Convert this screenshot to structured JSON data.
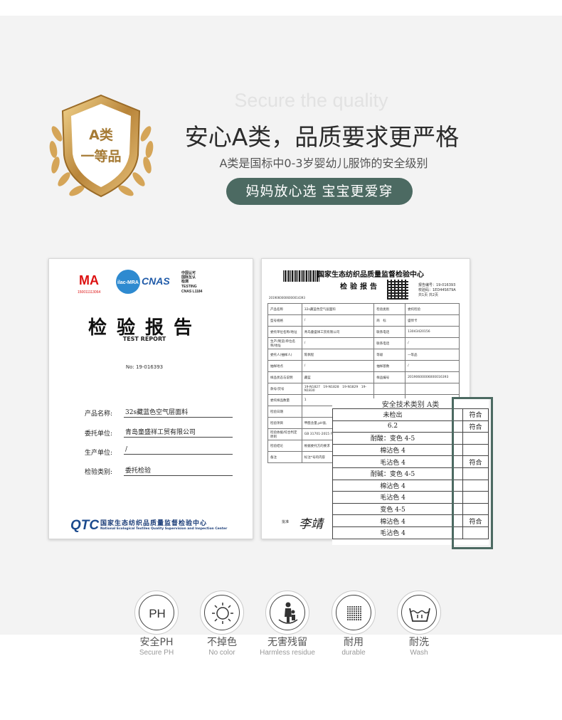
{
  "badge": {
    "line1": "A类",
    "line2": "一等品"
  },
  "header": {
    "subtitle_en": "Secure the quality",
    "headline": "安心A类，品质要求更严格",
    "description": "A类是国标中0-3岁婴幼儿服饰的安全级别",
    "pill": "妈妈放心选 宝宝更爱穿"
  },
  "report_cover": {
    "logo_ma": "MA",
    "logo_ma_number": "150011113064",
    "logo_ilac": "ilac-MRA",
    "logo_cnas": "CNAS",
    "cnas_cn_1": "中国认可",
    "cnas_cn_2": "国际互认",
    "cnas_cn_3": "检测",
    "cnas_testing": "TESTING",
    "cnas_number": "CNAS L1184",
    "title": "检验报告",
    "title_en": "TEST REPORT",
    "report_no": "No: 19-016393",
    "fields": [
      {
        "label": "产品名称:",
        "value": "32s藏蓝色空气层面料"
      },
      {
        "label": "委托单位:",
        "value": "青岛童盛祥工贸有限公司"
      },
      {
        "label": "生产单位:",
        "value": "/"
      },
      {
        "label": "检验类别:",
        "value": "委托检验"
      }
    ],
    "footer_logo": "QTC",
    "footer_cn": "国家生态纺织品质量监督检验中心",
    "footer_en": "National Ecological Textiles Quality Supervision and Inspection Center"
  },
  "report_detail": {
    "title": "国家生态纺织品质量监督检验中心",
    "subtitle": "检验报告",
    "barcode_number": "20190600006000014393",
    "report_no": "报告编号：19-016393",
    "check_no": "校验码：1ED44S679A",
    "page": "共1页 共2页",
    "rows": [
      [
        "产品名称",
        "32s藏蓝色空气层面料",
        "检验类别",
        "委托检验"
      ],
      [
        "型号规格",
        "/",
        "商　标",
        "盛悍卡"
      ],
      [
        "委托单位名称/地址",
        "青岛童盛祥工贸有限公司",
        "联系电话",
        "13043420156"
      ],
      [
        "生产(制造)单位名称/地址",
        "/",
        "联系电话",
        "/"
      ],
      [
        "委托人(抽样人)",
        "陈佩程",
        "等级",
        "一等品"
      ],
      [
        "抽样地点",
        "/",
        "抽样基数",
        "/"
      ],
      [
        "样品状态与说明",
        "藏蓝",
        "样品编号",
        "20190600006000016393"
      ],
      [
        "款号/货号",
        "19-N1827　19-N1828　19-N1829　19-N1830",
        "",
        ""
      ],
      [
        "委托样品数量",
        "1",
        "",
        ""
      ],
      [
        "检验日期",
        "",
        "",
        ""
      ],
      [
        "检验项目",
        "甲醛含量,pH值,",
        "",
        ""
      ],
      [
        "检验依据/综合判定原则",
        "GB 31701-2015 FZ/T 73025-2019",
        "",
        ""
      ],
      [
        "检验结论",
        "根据委托方的要求",
        "",
        ""
      ],
      [
        "备注",
        "标注*号的内容",
        "",
        ""
      ]
    ],
    "signer_label": "批准",
    "signature": "李靖"
  },
  "results_table": {
    "header": "安全技术类别 A类",
    "rows": [
      {
        "value": "未检出",
        "result": "符合"
      },
      {
        "value": "6.2",
        "result": "符合"
      },
      {
        "value": "耐酸：变色 4-5",
        "result": ""
      },
      {
        "value": "棉沾色 4",
        "result": ""
      },
      {
        "value": "毛沾色 4",
        "result": "符合"
      },
      {
        "value": "耐碱：变色 4-5",
        "result": ""
      },
      {
        "value": "棉沾色 4",
        "result": ""
      },
      {
        "value": "毛沾色 4",
        "result": ""
      },
      {
        "value": "变色 4-5",
        "result": ""
      },
      {
        "value": "棉沾色 4",
        "result": "符合"
      },
      {
        "value": "毛沾色 4",
        "result": ""
      }
    ]
  },
  "features": [
    {
      "cn": "安全PH",
      "en": "Secure PH",
      "icon": "ph-icon"
    },
    {
      "cn": "不掉色",
      "en": "No color",
      "icon": "sun-icon"
    },
    {
      "cn": "无害残留",
      "en": "Harmless residue",
      "icon": "family-icon"
    },
    {
      "cn": "耐用",
      "en": "durable",
      "icon": "fabric-icon"
    },
    {
      "cn": "耐洗",
      "en": "Wash",
      "icon": "wash-icon"
    }
  ],
  "colors": {
    "accent": "#4c6a62",
    "gold": "#c9a051"
  }
}
